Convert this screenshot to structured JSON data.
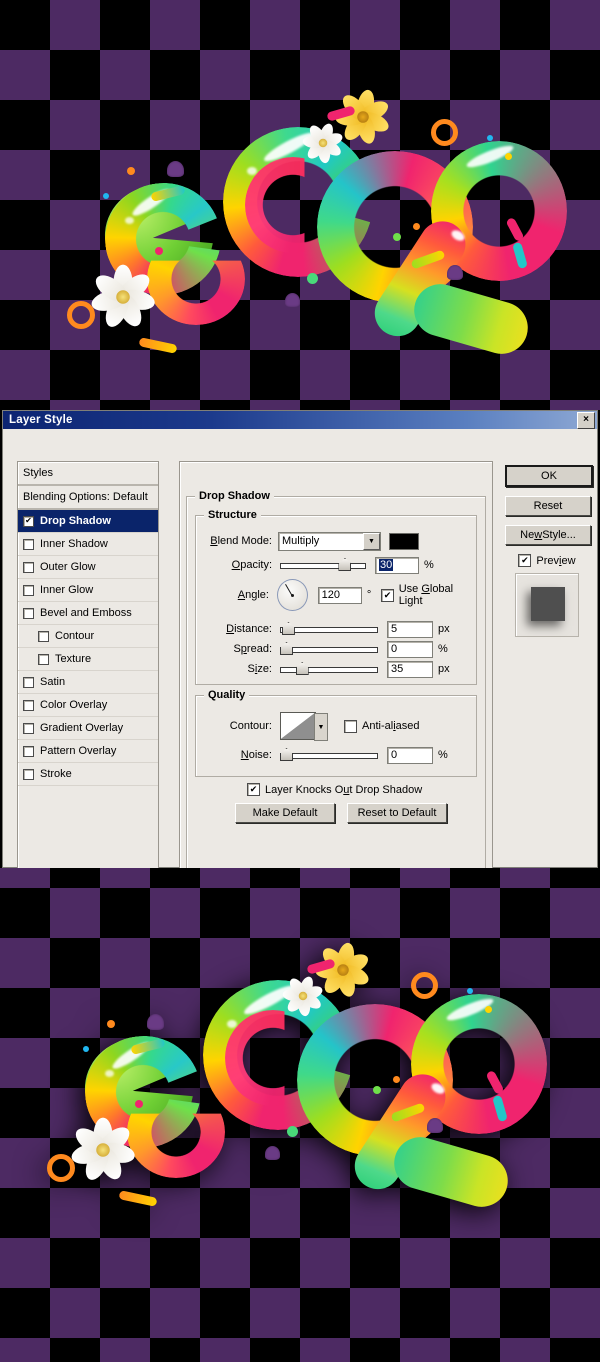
{
  "artwork": {
    "name": "cool-lettering-artwork",
    "word": "cool",
    "background_pattern": "purple-black-argyle-diamonds",
    "colors": {
      "purple": "#4d2a63",
      "black": "#000000"
    },
    "top_caption": "",
    "bottom_caption": ""
  },
  "dialog": {
    "title": "Layer Style",
    "close_label": "×",
    "styles_list": [
      {
        "label": "Styles",
        "checkbox": false,
        "indent": false,
        "selected": false,
        "header": true
      },
      {
        "label": "Blending Options: Default",
        "checkbox": false,
        "indent": false,
        "selected": false,
        "header": true
      },
      {
        "label": "Drop Shadow",
        "checkbox": true,
        "checked": true,
        "indent": false,
        "selected": true
      },
      {
        "label": "Inner Shadow",
        "checkbox": true,
        "checked": false,
        "indent": false,
        "selected": false
      },
      {
        "label": "Outer Glow",
        "checkbox": true,
        "checked": false,
        "indent": false,
        "selected": false
      },
      {
        "label": "Inner Glow",
        "checkbox": true,
        "checked": false,
        "indent": false,
        "selected": false
      },
      {
        "label": "Bevel and Emboss",
        "checkbox": true,
        "checked": false,
        "indent": false,
        "selected": false
      },
      {
        "label": "Contour",
        "checkbox": true,
        "checked": false,
        "indent": true,
        "selected": false
      },
      {
        "label": "Texture",
        "checkbox": true,
        "checked": false,
        "indent": true,
        "selected": false
      },
      {
        "label": "Satin",
        "checkbox": true,
        "checked": false,
        "indent": false,
        "selected": false
      },
      {
        "label": "Color Overlay",
        "checkbox": true,
        "checked": false,
        "indent": false,
        "selected": false
      },
      {
        "label": "Gradient Overlay",
        "checkbox": true,
        "checked": false,
        "indent": false,
        "selected": false
      },
      {
        "label": "Pattern Overlay",
        "checkbox": true,
        "checked": false,
        "indent": false,
        "selected": false
      },
      {
        "label": "Stroke",
        "checkbox": true,
        "checked": false,
        "indent": false,
        "selected": false
      }
    ],
    "section": {
      "title": "Drop Shadow",
      "structure_title": "Structure",
      "quality_title": "Quality"
    },
    "structure": {
      "blend_mode_label": "Blend Mode:",
      "blend_mode_value": "Multiply",
      "blend_mode_arrow": "▼",
      "shadow_color": "#000000",
      "opacity_label": "Opacity:",
      "opacity_value": "30",
      "opacity_unit": "%",
      "angle_label": "Angle:",
      "angle_value": "120",
      "angle_unit": "°",
      "global_light_label": "Use Global Light",
      "global_light_checked": "✔",
      "distance_label": "Distance:",
      "distance_value": "5",
      "distance_unit": "px",
      "spread_label": "Spread:",
      "spread_value": "0",
      "spread_unit": "%",
      "size_label": "Size:",
      "size_value": "35",
      "size_unit": "px"
    },
    "quality": {
      "contour_label": "Contour:",
      "contour_arrow": "▼",
      "anti_aliased_label": "Anti-aliased",
      "anti_aliased_checked": "",
      "noise_label": "Noise:",
      "noise_value": "0",
      "noise_unit": "%"
    },
    "knockout": {
      "label": "Layer Knocks Out Drop Shadow",
      "checked": "✔"
    },
    "default_buttons": {
      "make_default": "Make Default",
      "reset_to_default": "Reset to Default"
    },
    "right_buttons": {
      "ok": "OK",
      "reset": "Reset",
      "new_style": "New Style...",
      "preview_label": "Preview",
      "preview_checked": "✔"
    }
  }
}
